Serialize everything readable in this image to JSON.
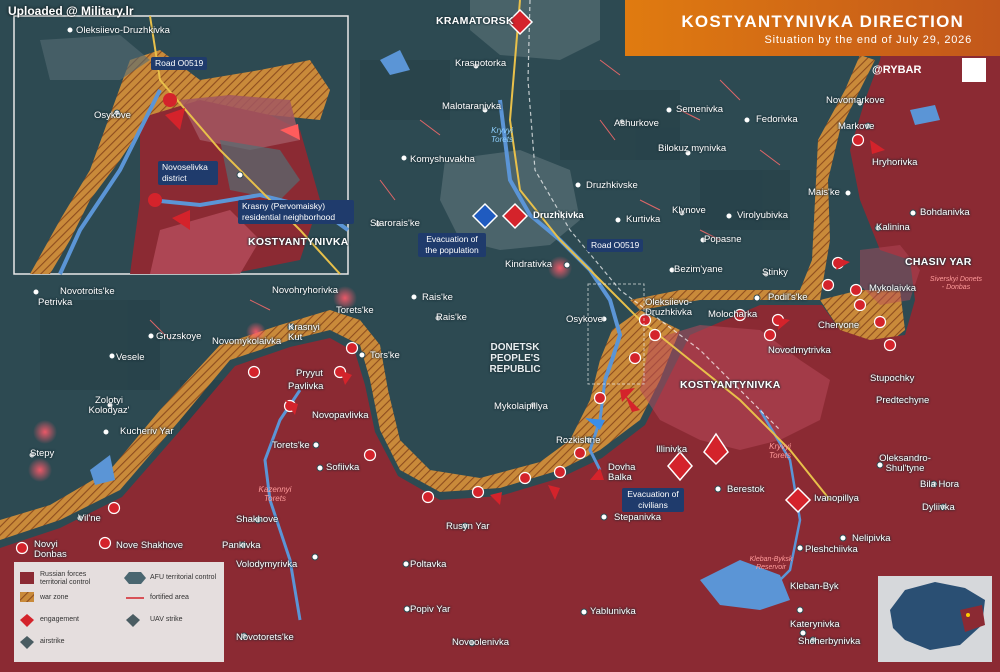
{
  "watermark": "Uploaded @ Military.lr",
  "title": {
    "main": "KOSTYANTYNIVKA DIRECTION",
    "subtitle": "Situation by the end of July 29, 2026"
  },
  "brand": "@RYBAR",
  "colors": {
    "russian_forces": "#8b2a33",
    "afu_territory": "#2d4a52",
    "war_zone": "#e0902a",
    "engagement": "#d4232b",
    "evacuation_blue": "#1f5bc0",
    "callout": "#1f3b6c"
  },
  "cities": {
    "kramatorsk": "KRAMATORSK",
    "kostyantynivka": "KOSTYANTYNIVKA",
    "druzhkivka": "Druzhkivka",
    "chasiv_yar": "CHASIV YAR"
  },
  "region_label": "DONETSK PEOPLE'S REPUBLIC",
  "rivers": {
    "kryvyi_torets_1": "Kryvyi Torets",
    "kryvyi_torets_2": "Kryvyi Torets",
    "kazennyi_torets": "Kazennyi Torets",
    "siverskyi_donets": "Siverskyi Donets - Donbas",
    "reservoir": "Kleban-Byksk Reservoir"
  },
  "callouts": {
    "road_main": "Road O0519",
    "road_inset": "Road O0519",
    "evacuation_population": "Evacuation of the population",
    "evacuation_civilians": "Evacuation of civilians",
    "novoselivka": "Novoselivka district",
    "krasny": "Krasny (Pervomaisky) residential neighborhood"
  },
  "inset": {
    "kostyantynivka": "KOSTYANTYNIVKA",
    "oleksiievo": "Oleksiievo-Druzhkivka",
    "osykove": "Osykove"
  },
  "places": {
    "krasnotorka": "Krasnotorka",
    "malotaranivka": "Malotaranivka",
    "komyshuvakha": "Komyshuvakha",
    "ashurkove": "Ashurkove",
    "semenivka": "Semenivka",
    "fedorivka": "Fedorivka",
    "novomarkove": "Novomarkove",
    "markove": "Markove",
    "hryhorivka": "Hryhorivka",
    "bilokuz": "Bilokuz mynivka",
    "druzhkivske": "Druzhkivske",
    "maiske": "Mais'ke",
    "bohdanivka": "Bohdanivka",
    "kalinina": "Kalinina",
    "kurtivka": "Kurtivka",
    "klynove": "Klynove",
    "virolyubivka": "Virolyubivka",
    "starorais": "Starorais'ke",
    "popasne": "Popasne",
    "kindrativka": "Kindrativka",
    "bezimyane": "Bezim'yane",
    "stinky": "Stinky",
    "podilske": "Podil's'ke",
    "mykolaivka": "Mykolaivka",
    "oleksiievo_main": "Oleksiievo-Druzhkivka",
    "osykove": "Osykove",
    "molocharka": "Molocharka",
    "chervone": "Chervone",
    "novodmytrivka": "Novodmytrivka",
    "stupochky": "Stupochky",
    "predtechyne": "Predtechyne",
    "novotroitske": "Novotroits'ke",
    "petrivka": "Petrivka",
    "novohryhorivka": "Novohryhorivka",
    "raiske_1": "Rais'ke",
    "raiske_2": "Rais'ke",
    "toretske_1": "Torets'ke",
    "gruzskoye": "Gruzskoye",
    "novomykolaivka": "Novomykolaivka",
    "krasnyi_kut": "Krasnyi Kut",
    "vesele": "Vesele",
    "torske": "Tors'ke",
    "pryyut": "Pryyut",
    "pavlivka": "Pavlivka",
    "zolotyi": "Zolotyi Kolodyaz'",
    "novopavlivka": "Novopavlivka",
    "mykolaipillya": "Mykolaipillya",
    "kucheriv": "Kucheriv Yar",
    "stepy": "Stepy",
    "toretske_2": "Torets'ke",
    "sofiivka": "Sofiivka",
    "rozkishne": "Rozkishne",
    "illinivka": "Illinivka",
    "dovha_balka": "Dovha Balka",
    "berestok": "Berestok",
    "ivanopillya": "Ivanopillya",
    "oleksandro": "Oleksandro-Shul'tyne",
    "bila_hora": "Bila Hora",
    "dyliivka": "Dyliivka",
    "vilne": "Vil'ne",
    "shakhove": "Shakhove",
    "rusyn_yar": "Rusyn Yar",
    "stepanivka": "Stepanivka",
    "novyi_donbas": "Novyi Donbas",
    "nove_shakhove": "Nove Shakhove",
    "pankivka": "Pankivka",
    "volodymyrivka": "Volodymyrivka",
    "poltavka": "Poltavka",
    "nelipivka": "Nelipivka",
    "pleshchiivka": "Pleshchiivka",
    "kleban_byk": "Kleban-Byk",
    "popiv_yar": "Popiv Yar",
    "yablunivka": "Yablunivka",
    "katerynivka": "Katerynivka",
    "novotoretske": "Novotorets'ke",
    "novoolenivka": "Novoolenivka",
    "shcherbynivka": "Shcherbynivka"
  },
  "legend": {
    "russian": "Russian forces territorial control",
    "afu": "AFU territorial control",
    "war_zone": "war zone",
    "fortified": "fortified area",
    "engagement": "engagement",
    "uav": "UAV strike",
    "airstrike": "airstrike"
  }
}
